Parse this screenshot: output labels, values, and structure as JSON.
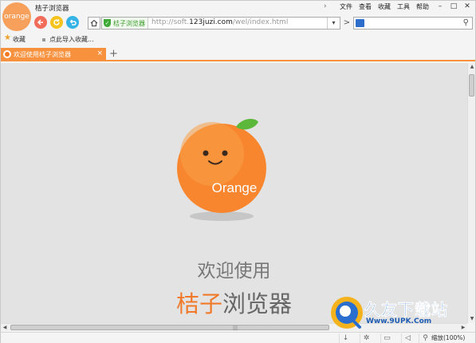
{
  "window": {
    "title": "桔子浏览器",
    "logo_text": "orange",
    "menu": [
      "文件",
      "查看",
      "收藏",
      "工具",
      "帮助"
    ],
    "controls": [
      "–",
      "□",
      "✕"
    ]
  },
  "nav": {
    "back_icon": "back-arrow-icon",
    "refresh_icon": "refresh-icon",
    "undo_icon": "undo-icon",
    "home_icon": "home-icon"
  },
  "address_bar": {
    "security_label": "桔子浏览器",
    "url_prefix": "http://soft.",
    "url_host": "123juzi.com",
    "url_path": "/wel/index.html",
    "dropdown_glyph": "▾",
    "go_glyph": ">"
  },
  "search": {
    "value": "",
    "icon": "search-icon"
  },
  "bookmarks": {
    "favorites_label": "收藏",
    "import_label": "点此导入收藏..."
  },
  "tabs": [
    {
      "label": "欢迎使用桔子浏览器",
      "active": true,
      "close": "×"
    }
  ],
  "new_tab": "+",
  "page": {
    "mascot_text": "Orange",
    "welcome": "欢迎使用",
    "brand_highlight": "桔子",
    "brand_rest": "浏览器"
  },
  "statusbar": {
    "zoom_label": "缩放(100%)"
  },
  "watermark": {
    "title": "久友下载站",
    "url": "Www.9UPK.Com"
  },
  "colors": {
    "accent_orange": "#f7913d",
    "back_red": "#f26c5a",
    "refresh_yellow": "#f6c31c",
    "undo_blue": "#35b3e6",
    "secure_green": "#3a9a2b",
    "content_bg": "#e3e3e3"
  }
}
